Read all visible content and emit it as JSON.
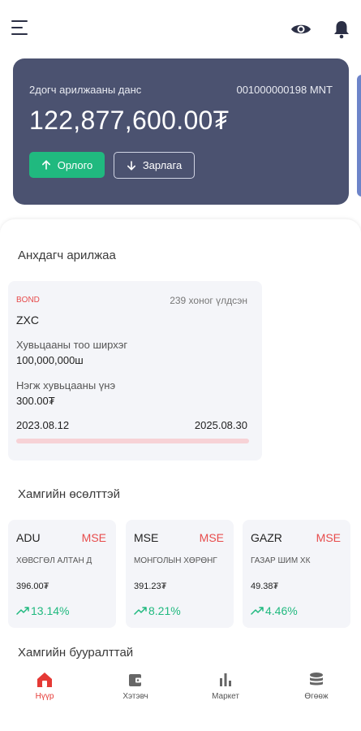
{
  "account": {
    "name": "2догч арилжааны данс",
    "number": "001000000198 MNT",
    "balance": "122,877,600.00₮",
    "income_label": "Орлого",
    "expense_label": "Зарлага"
  },
  "primary_section": {
    "title": "Анхдагч арилжаа",
    "bond": {
      "tag": "BOND",
      "days_left": "239 хоног үлдсэн",
      "code": "ZXC",
      "quantity_label": "Хувьцааны тоо ширхэг",
      "quantity_value": "100,000,000ш",
      "unit_price_label": "Нэгж хувьцааны үнэ",
      "unit_price_value": "300.00₮",
      "start_date": "2023.08.12",
      "end_date": "2025.08.30"
    }
  },
  "gainers": {
    "title": "Хамгийн өсөлттэй",
    "items": [
      {
        "ticker": "ADU",
        "exchange": "MSE",
        "name": "ХӨВСГӨЛ АЛТАН Д",
        "price": "396.00₮",
        "change": "13.14%"
      },
      {
        "ticker": "MSE",
        "exchange": "MSE",
        "name": "МОНГОЛЫН ХӨРӨНГ",
        "price": "391.23₮",
        "change": "8.21%"
      },
      {
        "ticker": "GAZR",
        "exchange": "MSE",
        "name": "ГАЗАР ШИМ ХК",
        "price": "49.38₮",
        "change": "4.46%"
      }
    ]
  },
  "losers": {
    "title": "Хамгийн бууралттай"
  },
  "nav": {
    "items": [
      {
        "label": "Нүүр"
      },
      {
        "label": "Хэтэвч"
      },
      {
        "label": "Маркет"
      },
      {
        "label": "Өгөөж"
      }
    ]
  },
  "colors": {
    "card_bg": "#4b5270",
    "income_green": "#20b97f",
    "accent_red": "#e53935",
    "gain_green": "#20b97f"
  }
}
